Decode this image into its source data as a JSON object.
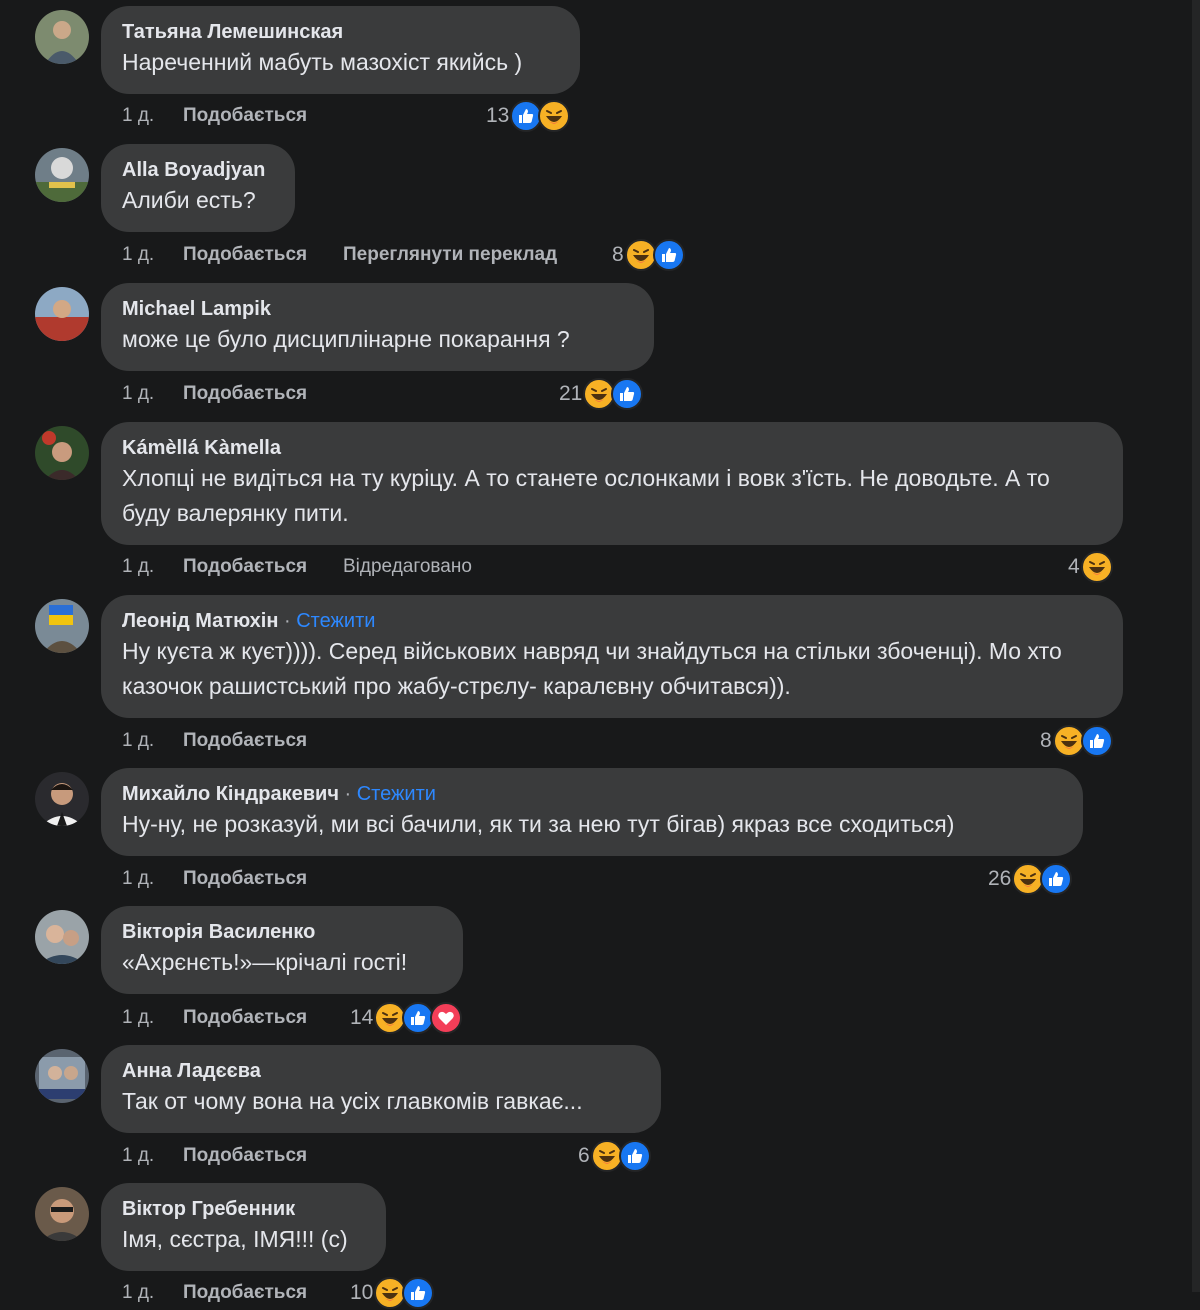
{
  "ui": {
    "like_label": "Подобається",
    "follow_label": "Стежити",
    "separator": "·"
  },
  "comments": [
    {
      "author": "Татьяна Лемешинская",
      "text": "Нареченний мабуть мазохіст якийсь )",
      "time": "1 д.",
      "reactions_count": "13",
      "reactions": [
        "like",
        "haha"
      ]
    },
    {
      "author": "Alla Boyadjyan",
      "text": "Алиби есть?",
      "time": "1 д.",
      "translate_label": "Переглянути переклад",
      "reactions_count": "8",
      "reactions": [
        "haha",
        "like"
      ]
    },
    {
      "author": "Michael Lampik",
      "text": "може це було дисциплінарне покарання ?",
      "time": "1 д.",
      "reactions_count": "21",
      "reactions": [
        "haha",
        "like"
      ]
    },
    {
      "author": "Kámèllá Kàmella",
      "text": "Хлопці не видіться на ту куріцу. А то станете ослонками і вовк з'їсть. Не доводьте. А то буду валерянку пити.",
      "time": "1 д.",
      "edited_label": "Відредаговано",
      "reactions_count": "4",
      "reactions": [
        "haha"
      ]
    },
    {
      "author": "Леонід Матюхін",
      "follow": true,
      "text": "Ну куєта ж куєт)))). Серед військових навряд чи знайдуться на стільки збоченці). Мо хто казочок рашистський про жабу-стрєлу- каралєвну обчитався)).",
      "time": "1 д.",
      "reactions_count": "8",
      "reactions": [
        "haha",
        "like"
      ]
    },
    {
      "author": "Михайло Кіндракевич",
      "follow": true,
      "text": "Ну-ну, не розказуй, ми всі бачили, як ти за нею тут бігав) якраз все сходиться)",
      "time": "1 д.",
      "reactions_count": "26",
      "reactions": [
        "haha",
        "like"
      ]
    },
    {
      "author": "Вікторія Василенко",
      "text": "«Ахрєнєть!»—крічалі гості!",
      "time": "1 д.",
      "reactions_count": "14",
      "reactions": [
        "haha",
        "like",
        "love"
      ]
    },
    {
      "author": "Анна Ладєєва",
      "text": "Так от чому вона на усіх главкомів гавкає...",
      "time": "1 д.",
      "reactions_count": "6",
      "reactions": [
        "haha",
        "like"
      ]
    },
    {
      "author": "Віктор Гребенник",
      "text": "Імя, сєстра, ІМЯ!!! (с)",
      "time": "1 д.",
      "reactions_count": "10",
      "reactions": [
        "haha",
        "like"
      ]
    }
  ],
  "colors": {
    "background": "#18191a",
    "bubble": "#3a3b3c",
    "link": "#2d88ff",
    "like_blue": "#1877f2",
    "haha_yellow": "#f7b125",
    "love_red": "#f33e58"
  }
}
